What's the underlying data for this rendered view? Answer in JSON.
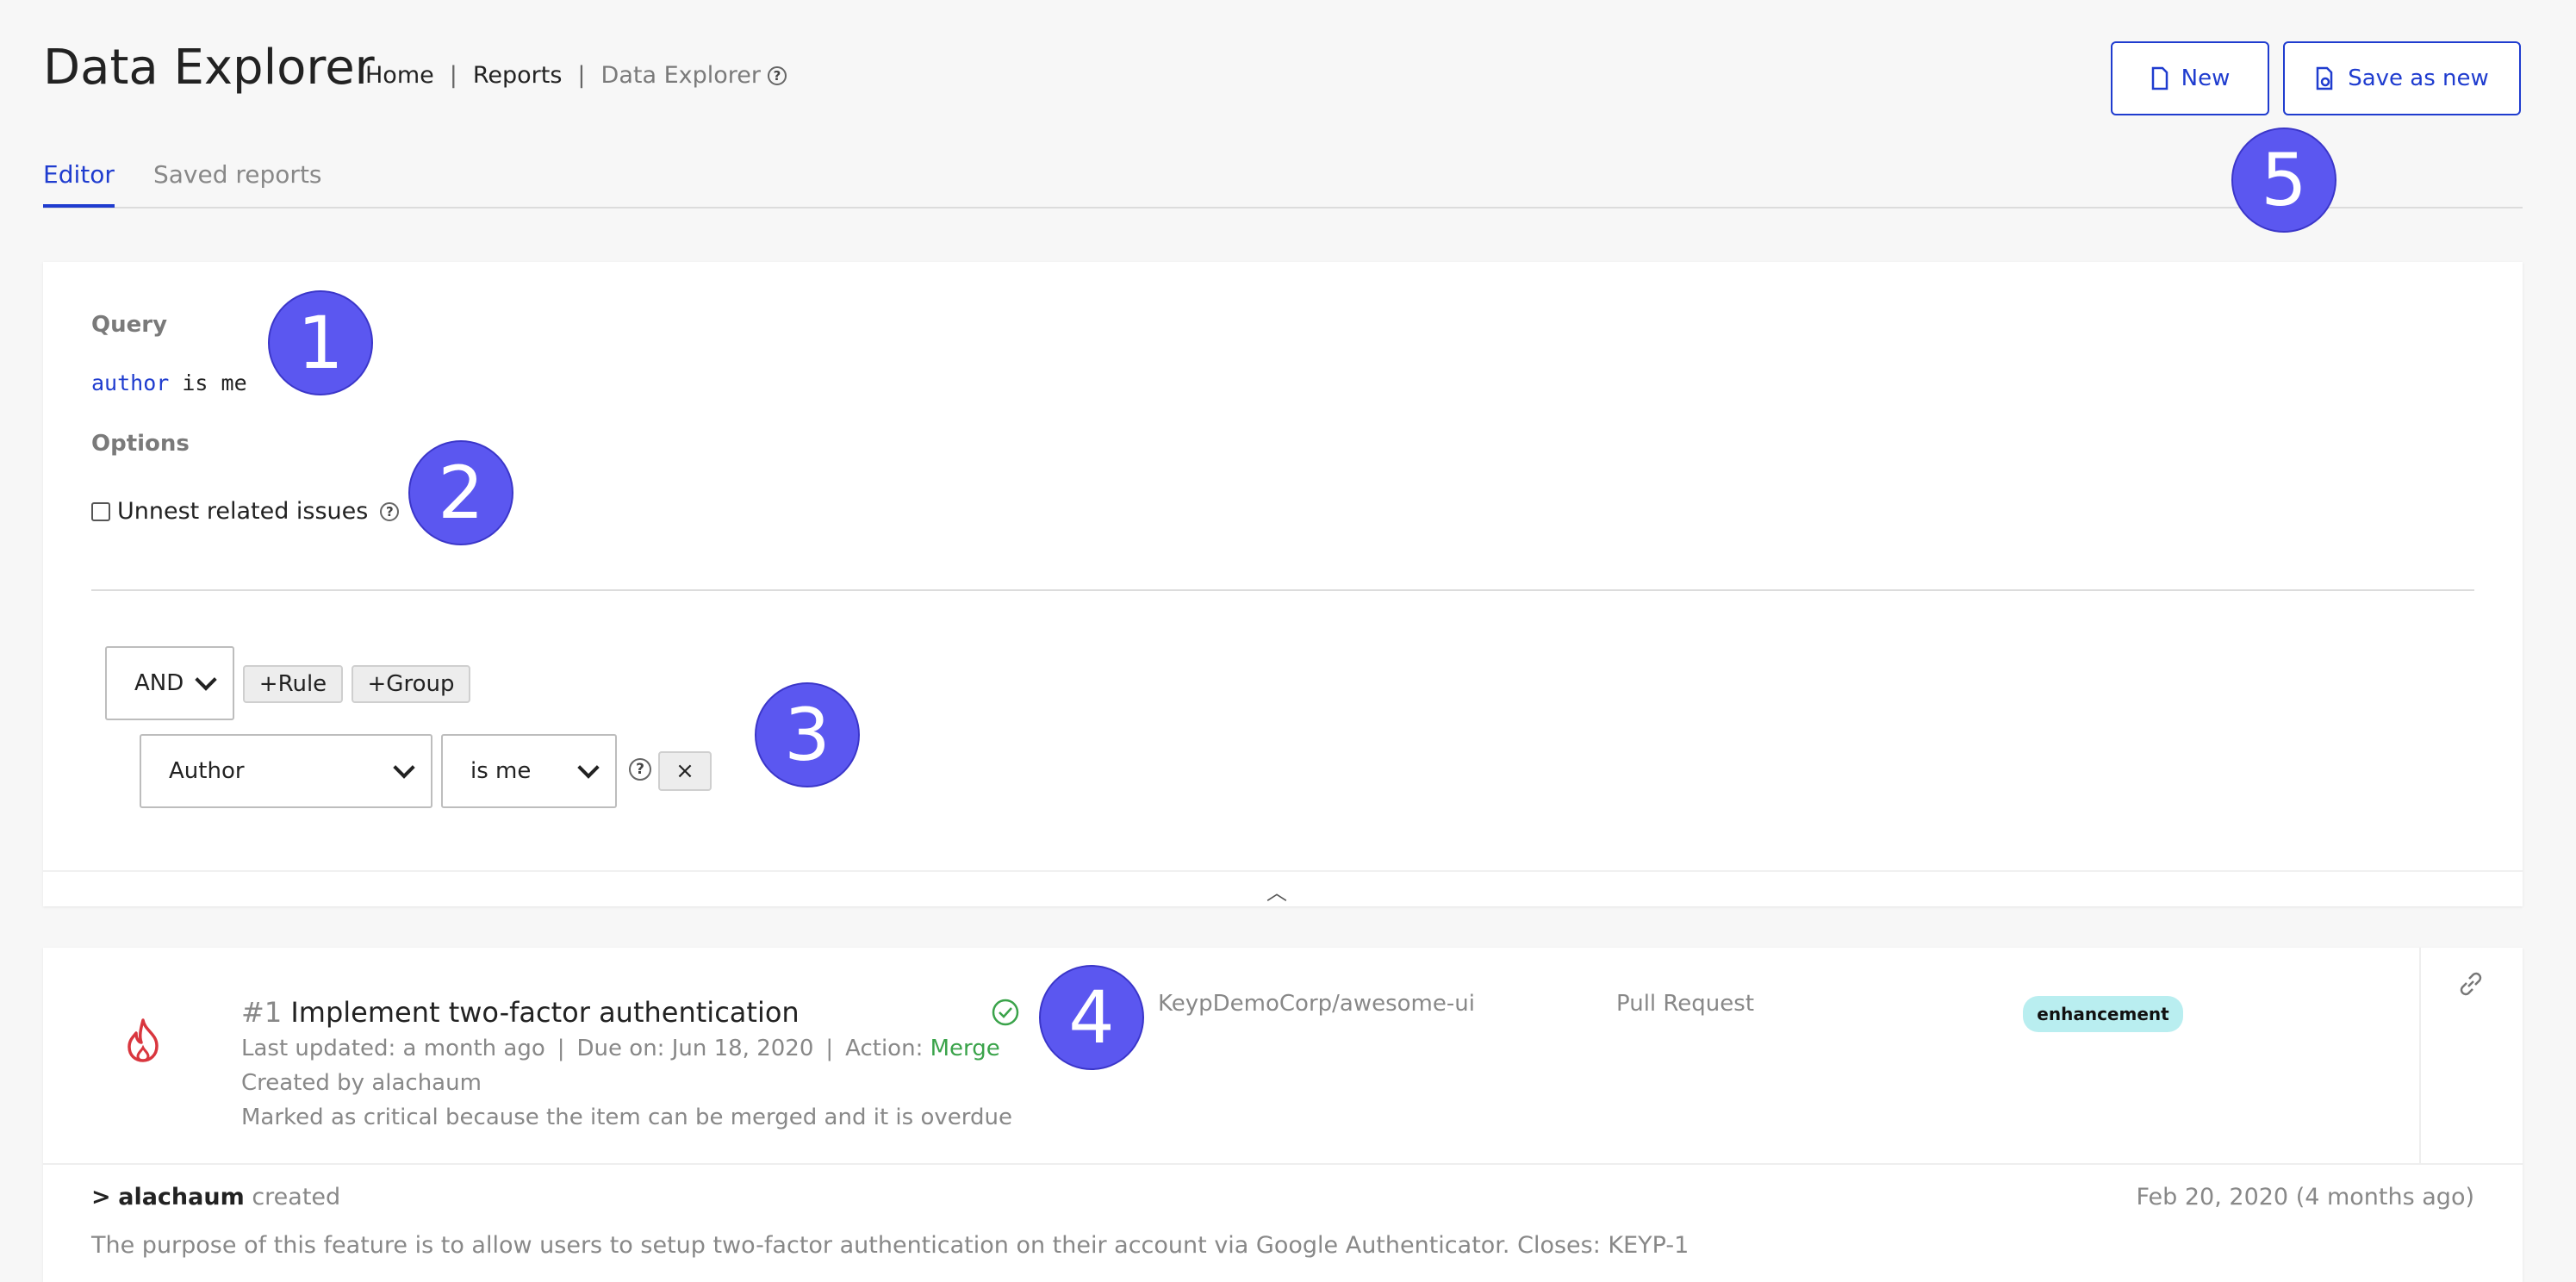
{
  "header": {
    "title": "Data Explorer",
    "breadcrumb": {
      "home": "Home",
      "reports": "Reports",
      "current": "Data Explorer",
      "sep": "|"
    },
    "help_glyph": "?",
    "buttons": {
      "new_label": "New",
      "save_as_new_label": "Save as new"
    }
  },
  "tabs": [
    {
      "label": "Editor",
      "active": true
    },
    {
      "label": "Saved reports",
      "active": false
    }
  ],
  "query": {
    "label": "Query",
    "keyword": "author",
    "rest": " is me",
    "options_label": "Options",
    "unnest_label": "Unnest related issues",
    "unnest_checked": false
  },
  "builder": {
    "combinator": "AND",
    "add_rule": "+Rule",
    "add_group": "+Group",
    "rule": {
      "field": "Author",
      "operator": "is me",
      "remove": "×"
    },
    "collapse_glyph": "︿"
  },
  "markers": [
    "1",
    "2",
    "3",
    "4",
    "5"
  ],
  "issue": {
    "number": "#1",
    "title": "Implement two-factor authentication",
    "meta": {
      "updated": "Last updated: a month ago",
      "sep": "|",
      "due": "Due on: Jun 18, 2020",
      "action_label": "Action:",
      "action_value": "Merge"
    },
    "created_by": "Created by alachaum",
    "critical_note": "Marked as critical because the item can be merged and it is overdue",
    "repo": "KeypDemoCorp/awesome-ui",
    "type": "Pull Request",
    "badge": "enhancement",
    "activity": {
      "prefix": ">",
      "user": "alachaum",
      "verb": "created",
      "date": "Feb 20, 2020 (4 months ago)",
      "description": "The purpose of this feature is to allow users to setup two-factor authentication on their account via Google Authenticator. Closes: KEYP-1"
    }
  },
  "colors": {
    "accent": "#1f3ccf",
    "marker": "#5b57f0",
    "flame": "#d9363e",
    "success": "#3aa34a",
    "badge_bg": "#b9eef0"
  },
  "icons": [
    "document-icon",
    "save-document-icon",
    "help-icon",
    "flame-icon",
    "check-circle-icon",
    "link-icon",
    "chevron-up-icon"
  ]
}
